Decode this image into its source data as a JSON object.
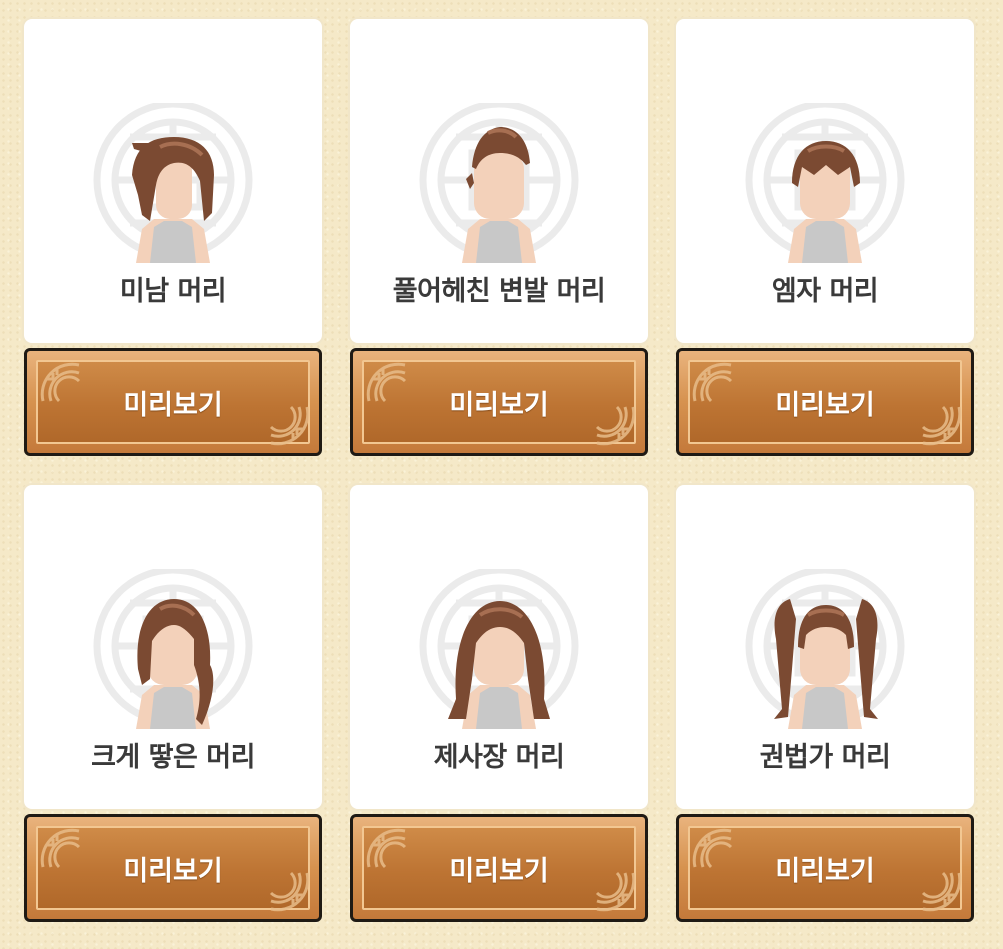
{
  "hairstyles": [
    {
      "name": "미남 머리",
      "button_label": "미리보기",
      "style": "handsome"
    },
    {
      "name": "풀어헤친 변발 머리",
      "button_label": "미리보기",
      "style": "topknot"
    },
    {
      "name": "엠자 머리",
      "button_label": "미리보기",
      "style": "mshape"
    },
    {
      "name": "크게 땋은 머리",
      "button_label": "미리보기",
      "style": "braid"
    },
    {
      "name": "제사장 머리",
      "button_label": "미리보기",
      "style": "priest"
    },
    {
      "name": "권법가 머리",
      "button_label": "미리보기",
      "style": "twintail"
    }
  ],
  "colors": {
    "page_bg": "#f5e9c8",
    "card_bg": "#ffffff",
    "button_bg": "#c4793a",
    "button_text": "#ffffff",
    "name_text": "#3a3a3a",
    "hair": "#7b4a32",
    "hair_highlight": "#a76f52",
    "skin": "#f3d1ba",
    "shirt": "#c8c8c8"
  },
  "icons": {
    "background_emblem": "chinese-longevity-emblem-icon",
    "button_ornament": "cloud-ornament-icon"
  }
}
